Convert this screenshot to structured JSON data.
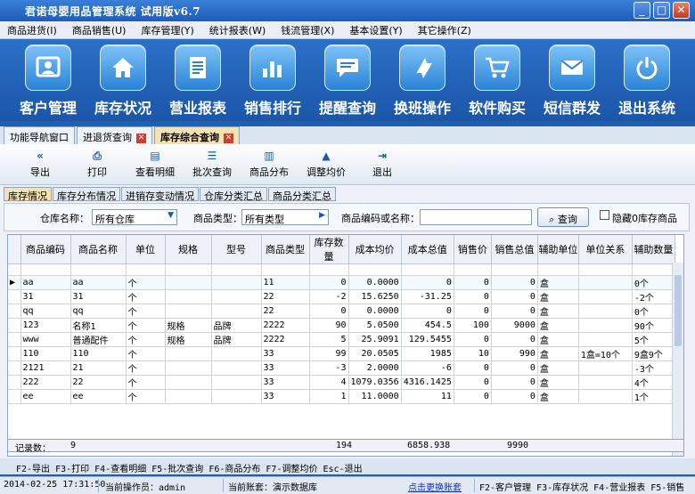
{
  "window": {
    "title": "君诺母婴用品管理系统 试用版v6.7",
    "min": "_",
    "max": "□",
    "close": "✕"
  },
  "menu": [
    "商品进货(I)",
    "商品销售(U)",
    "库存管理(Y)",
    "统计报表(W)",
    "钱流管理(X)",
    "基本设置(Y)",
    "其它操作(Z)"
  ],
  "bigbar": [
    {
      "label": "客户管理",
      "icon": "customer-icon"
    },
    {
      "label": "库存状况",
      "icon": "home-icon"
    },
    {
      "label": "营业报表",
      "icon": "report-icon"
    },
    {
      "label": "销售排行",
      "icon": "bar-chart-icon"
    },
    {
      "label": "提醒查询",
      "icon": "message-icon"
    },
    {
      "label": "换班操作",
      "icon": "switch-icon"
    },
    {
      "label": "软件购买",
      "icon": "cart-icon"
    },
    {
      "label": "短信群发",
      "icon": "mail-icon"
    },
    {
      "label": "退出系统",
      "icon": "power-icon"
    }
  ],
  "doc_tabs": [
    {
      "label": "功能导航窗口",
      "closable": false
    },
    {
      "label": "进退货查询",
      "closable": true
    },
    {
      "label": "库存综合查询",
      "closable": true,
      "active": true
    }
  ],
  "toolbar": [
    {
      "label": "导出",
      "icon": "export-icon",
      "glyph": "«"
    },
    {
      "label": "打印",
      "icon": "printer-icon",
      "glyph": "⎙"
    },
    {
      "label": "查看明细",
      "icon": "detail-icon",
      "glyph": "▤"
    },
    {
      "label": "批次查询",
      "icon": "batch-icon",
      "glyph": "☰"
    },
    {
      "label": "商品分布",
      "icon": "book-icon",
      "glyph": "▥"
    },
    {
      "label": "调整均价",
      "icon": "up-triangle-icon",
      "glyph": "▲"
    },
    {
      "label": "退出",
      "icon": "exit-door-icon",
      "glyph": "⇥"
    }
  ],
  "sub_tabs": [
    "库存情况",
    "库存分布情况",
    "进销存变动情况",
    "仓库分类汇总",
    "商品分类汇总"
  ],
  "filter": {
    "warehouse_label": "仓库名称：",
    "warehouse_value": "所有仓库",
    "type_label": "商品类型：",
    "type_value": "所有类型",
    "code_label": "商品编码或名称：",
    "code_value": "",
    "query_label": "查询",
    "hide_zero_label": "隐藏0库存商品"
  },
  "table": {
    "columns": [
      "商品编码",
      "商品名称",
      "单位",
      "规格",
      "型号",
      "商品类型",
      "库存数量",
      "成本均价",
      "成本总值",
      "销售价",
      "销售总值",
      "辅助单位",
      "单位关系",
      "辅助数量"
    ],
    "rows": [
      [
        "aa",
        "aa",
        "个",
        "",
        "",
        "11",
        "0",
        "0.0000",
        "0",
        "0",
        "0",
        "盒",
        "",
        "0个"
      ],
      [
        "31",
        "31",
        "个",
        "",
        "",
        "22",
        "-2",
        "15.6250",
        "-31.25",
        "0",
        "0",
        "盒",
        "",
        "-2个"
      ],
      [
        "qq",
        "qq",
        "个",
        "",
        "",
        "22",
        "0",
        "0.0000",
        "0",
        "0",
        "0",
        "盒",
        "",
        "0个"
      ],
      [
        "123",
        "名称1",
        "个",
        "规格",
        "品牌",
        "2222",
        "90",
        "5.0500",
        "454.5",
        "100",
        "9000",
        "盒",
        "",
        "90个"
      ],
      [
        "www",
        "普通配件",
        "个",
        "规格",
        "品牌",
        "2222",
        "5",
        "25.9091",
        "129.5455",
        "0",
        "0",
        "盒",
        "",
        "5个"
      ],
      [
        "110",
        "110",
        "个",
        "",
        "",
        "33",
        "99",
        "20.0505",
        "1985",
        "10",
        "990",
        "盒",
        "1盒=10个",
        "9盒9个"
      ],
      [
        "2121",
        "21",
        "个",
        "",
        "",
        "33",
        "-3",
        "2.0000",
        "-6",
        "0",
        "0",
        "盒",
        "",
        "-3个"
      ],
      [
        "222",
        "22",
        "个",
        "",
        "",
        "33",
        "4",
        "1079.0356",
        "4316.1425",
        "0",
        "0",
        "盒",
        "",
        "4个"
      ],
      [
        "ee",
        "ee",
        "个",
        "",
        "",
        "33",
        "1",
        "11.0000",
        "11",
        "0",
        "0",
        "盒",
        "",
        "1个"
      ]
    ],
    "footer": {
      "label": "记录数：",
      "count": "9",
      "qty_total": "194",
      "cost_total": "6858.938",
      "sales_total": "9990"
    }
  },
  "hotkeys": "F2-导出 F3-打印 F4-查看明细 F5-批次查询 F6-商品分布 F7-调整均价 Esc-退出",
  "status": {
    "datetime": "2014-02-25 17:31:50",
    "operator": "当前操作员：admin",
    "account": "当前账套：演示数据库",
    "switch_link": "点击更换账套",
    "shortcuts": "F2-客户管理 F3-库存状况 F4-营业报表 F5-销售"
  }
}
